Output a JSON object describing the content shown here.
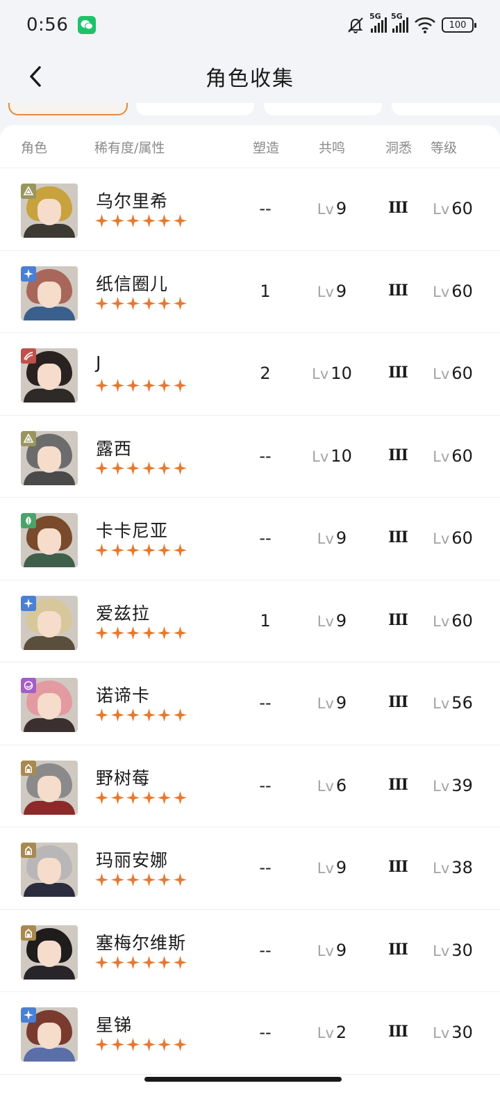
{
  "status": {
    "time": "0:56",
    "battery": "100",
    "net1": "5G",
    "net2": "5G"
  },
  "header": {
    "title": "角色收集"
  },
  "table": {
    "columns": {
      "role": "角色",
      "rarity": "稀有度/属性",
      "insight": "塑造",
      "resonance": "共鸣",
      "awareness": "洞悉",
      "level": "等级"
    },
    "lv_prefix": "Lv",
    "rows": [
      {
        "name": "乌尔里希",
        "attr": "triangle",
        "attr_color": "#9a9560",
        "hair": "#c8a23c",
        "body": "#3d3a33",
        "insight": "--",
        "resonance": "9",
        "awareness": "III",
        "level": "60",
        "stars": 6
      },
      {
        "name": "纸信圈儿",
        "attr": "star",
        "attr_color": "#4a7fd6",
        "hair": "#a8675a",
        "body": "#3a5f8c",
        "insight": "1",
        "resonance": "9",
        "awareness": "III",
        "level": "60",
        "stars": 6
      },
      {
        "name": "J",
        "attr": "wave",
        "attr_color": "#c0504b",
        "hair": "#2a2220",
        "body": "#2e2a28",
        "insight": "2",
        "resonance": "10",
        "awareness": "III",
        "level": "60",
        "stars": 6
      },
      {
        "name": "露西",
        "attr": "triangle",
        "attr_color": "#9a9560",
        "hair": "#6c6c6c",
        "body": "#4a4a4a",
        "insight": "--",
        "resonance": "10",
        "awareness": "III",
        "level": "60",
        "stars": 6
      },
      {
        "name": "卡卡尼亚",
        "attr": "leaf",
        "attr_color": "#4aa469",
        "hair": "#7a4a2c",
        "body": "#3f5f4a",
        "insight": "--",
        "resonance": "9",
        "awareness": "III",
        "level": "60",
        "stars": 6
      },
      {
        "name": "爱兹拉",
        "attr": "star",
        "attr_color": "#4a7fd6",
        "hair": "#d8c79a",
        "body": "#5a4f3c",
        "insight": "1",
        "resonance": "9",
        "awareness": "III",
        "level": "60",
        "stars": 6
      },
      {
        "name": "诺谛卡",
        "attr": "moon",
        "attr_color": "#a35ec8",
        "hair": "#e39aa0",
        "body": "#3c2f30",
        "insight": "--",
        "resonance": "9",
        "awareness": "III",
        "level": "56",
        "stars": 6
      },
      {
        "name": "野树莓",
        "attr": "gem",
        "attr_color": "#a8894f",
        "hair": "#8a8a8a",
        "body": "#8c2a2a",
        "insight": "--",
        "resonance": "6",
        "awareness": "III",
        "level": "39",
        "stars": 6
      },
      {
        "name": "玛丽安娜",
        "attr": "gem",
        "attr_color": "#a8894f",
        "hair": "#b9b6b8",
        "body": "#2b2d3e",
        "insight": "--",
        "resonance": "9",
        "awareness": "III",
        "level": "38",
        "stars": 6
      },
      {
        "name": "塞梅尔维斯",
        "attr": "gem",
        "attr_color": "#a8894f",
        "hair": "#1f1c1c",
        "body": "#27252a",
        "insight": "--",
        "resonance": "9",
        "awareness": "III",
        "level": "30",
        "stars": 6
      },
      {
        "name": "星锑",
        "attr": "star",
        "attr_color": "#4a7fd6",
        "hair": "#7a3a2e",
        "body": "#5a6ea8",
        "insight": "--",
        "resonance": "2",
        "awareness": "III",
        "level": "30",
        "stars": 6
      }
    ]
  },
  "colors": {
    "star": "#e8782e",
    "accent": "#e8893e"
  }
}
